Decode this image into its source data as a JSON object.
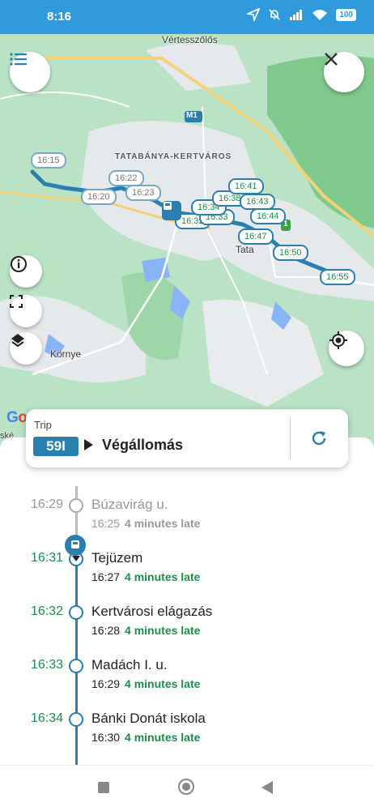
{
  "status_bar": {
    "time": "8:16",
    "battery": "100"
  },
  "map": {
    "place_labels": {
      "vertesszolos": "Vértesszőlős",
      "kertvaros": "TATABÁNYA-KERTVÁROS",
      "tata": "Tata",
      "kornye": "Környe",
      "highway": "M1",
      "road_1": "1",
      "skeletal_edge": "ské"
    },
    "stop_markers": [
      "16:15",
      "16:20",
      "16:22",
      "16:23",
      "16:32",
      "16:33",
      "16:34",
      "16:38",
      "16:41",
      "16:43",
      "16:44",
      "16:47",
      "16:50",
      "16:55"
    ],
    "icons": {
      "menu": "menu-icon",
      "close": "close-icon",
      "info": "info-icon",
      "fullscreen": "fullscreen-icon",
      "layers": "layers-icon",
      "locate": "my-location-icon"
    },
    "attribution": [
      "G",
      "o",
      "o",
      "g",
      "l",
      "e"
    ]
  },
  "trip_card": {
    "label": "Trip",
    "route": "59I",
    "destination": "Végállomás"
  },
  "stops": [
    {
      "scheduled": "16:29",
      "name": "Búzavirág u.",
      "actual": "16:25",
      "delay": "4 minutes late",
      "state": "past"
    },
    {
      "scheduled": "16:31",
      "name": "Tejüzem",
      "actual": "16:27",
      "delay": "4 minutes late",
      "state": "current"
    },
    {
      "scheduled": "16:32",
      "name": "Kertvárosi elágazás",
      "actual": "16:28",
      "delay": "4 minutes late",
      "state": "future"
    },
    {
      "scheduled": "16:33",
      "name": "Madách I. u.",
      "actual": "16:29",
      "delay": "4 minutes late",
      "state": "future"
    },
    {
      "scheduled": "16:34",
      "name": "Bánki Donát iskola",
      "actual": "16:30",
      "delay": "4 minutes late",
      "state": "future"
    }
  ],
  "colors": {
    "accent": "#2a7fae",
    "status_bar": "#2f9bdc",
    "on_time_green": "#1f8c4d",
    "past_grey": "#999999"
  }
}
